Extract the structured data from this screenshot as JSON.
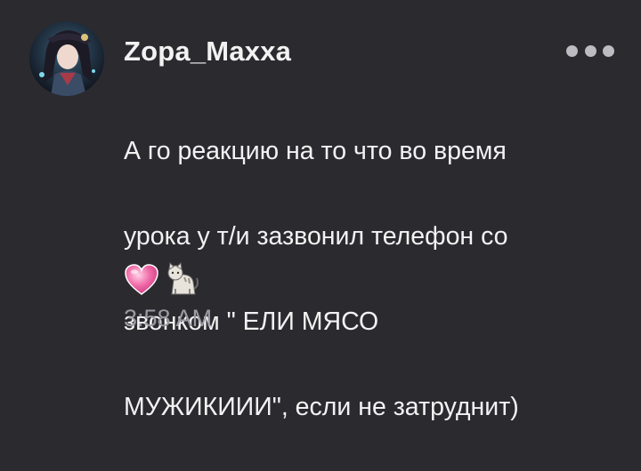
{
  "message": {
    "username": "Zopa_Maxxa",
    "text_lines": [
      "А го реакцию на то что во время",
      "урока у т/и зазвонил телефон со",
      "звонком \" ЕЛИ МЯСО",
      "МУЖИКИИИ\", если не затруднит)"
    ],
    "emojis": [
      "heart-icon",
      "cat-icon"
    ],
    "timestamp": "3:58 AM"
  },
  "colors": {
    "background": "#2b2a2f",
    "text": "#f2f2f2",
    "secondary_text": "#9c9ba3",
    "menu_dots": "#bdbcc3",
    "heart": "#f06ba8"
  }
}
